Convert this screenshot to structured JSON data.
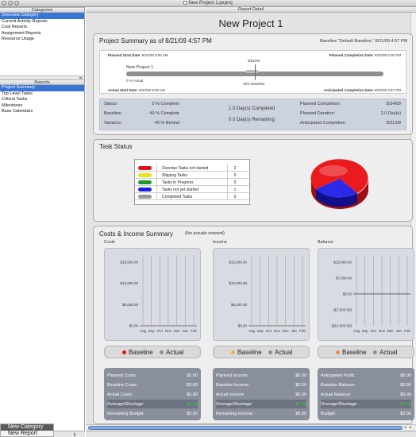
{
  "window": {
    "title": "New Project 1.pxproj"
  },
  "sidebar": {
    "categories_header": "Categories",
    "categories": [
      {
        "label": "Overview Category",
        "selected": true
      },
      {
        "label": "Current Activity Reports"
      },
      {
        "label": "Cost Reports"
      },
      {
        "label": "Assignment Reports"
      },
      {
        "label": "Resource Usage"
      }
    ],
    "reports_header": "Reports",
    "reports": [
      {
        "label": "Project Summary",
        "selected": true
      },
      {
        "label": "Top Level Tasks"
      },
      {
        "label": "Critical Tasks"
      },
      {
        "label": "Milestones"
      },
      {
        "label": "Base Calendars"
      }
    ]
  },
  "context_menu": {
    "items": [
      "New Category",
      "New Report"
    ]
  },
  "report": {
    "header": "Report Detail",
    "title": "New Project 1",
    "summary": {
      "title": "Project Summary as of 8/21/09 4:57 PM",
      "baseline": "Baseline \"Default Baseline,\" 8/21/09 4:57 PM",
      "planned_start": {
        "label": "Planned Start Date:",
        "value": "8/24/09 8:00 AM"
      },
      "planned_completion": {
        "label": "Planned Completion Date:",
        "value": "8/24/09 5:00 PM"
      },
      "actual_start": {
        "label": "Actual Start Date:",
        "value": "8/24/09 8:00 AM"
      },
      "anticipated_completion": {
        "label": "Anticipated Completion Date:",
        "value": "8/24/09 4:57 PM"
      },
      "today_marker": "8/21/09",
      "project_name": "New Project 1",
      "actual_pct": "0 % Actual",
      "baseline_pct": "49% Baseline",
      "actual_fraction": 0,
      "baseline_fraction": 0.49,
      "stats": {
        "status_label": "Status:",
        "status_value": "0 % Complete",
        "baseline_label": "Baseline:",
        "baseline_value": "49 % Complete",
        "variance_label": "Variance:",
        "variance_value": "49 % Behind",
        "days_completed": "1.0 Day(s) Completed",
        "days_remaining": "0.0 Day(s) Remaining",
        "planned_completion_label": "Planned Completion:",
        "planned_completion_value": "8/24/09",
        "planned_duration_label": "Planned Duration:",
        "planned_duration_value": "2.0 Day(s)",
        "anticipated_completion_label": "Anticipated Completion:",
        "anticipated_completion_value": "8/21/09"
      }
    },
    "task_status": {
      "title": "Task Status",
      "rows": [
        {
          "label": "Overdue Tasks not started",
          "count": "2",
          "color": "#e0141b"
        },
        {
          "label": "Slipping Tasks",
          "count": "0",
          "color": "#e8e21a"
        },
        {
          "label": "Tasks in Progress",
          "count": "0",
          "color": "#1a9a2a"
        },
        {
          "label": "Tasks not yet started",
          "count": "1",
          "color": "#1e1ee0"
        },
        {
          "label": "Completed Tasks",
          "count": "0",
          "color": "#9a9a9a"
        }
      ]
    },
    "costs_income": {
      "title": "Costs & Income Summary",
      "note": "(No actuals entered)",
      "months": [
        "Aug",
        "Sep",
        "Oct",
        "Nov",
        "Dec",
        "Jan",
        "Feb"
      ],
      "panels": [
        {
          "label": "Costs",
          "yticks": [
            "$15,000.00",
            "$10,000.00",
            "$5,000.00",
            "$0.00"
          ],
          "baseline_dot": "#e0141b",
          "legend_baseline": "Baseline",
          "legend_actual": "Actual",
          "rows": [
            {
              "k": "Planned Costs:",
              "v": "$0.00"
            },
            {
              "k": "Baseline Costs:",
              "v": "$0.00"
            },
            {
              "k": "Actual Costs:",
              "v": "$0.00"
            },
            {
              "k": "Overage/Shortage:",
              "v": "$0.00",
              "hl": true,
              "green": true
            },
            {
              "k": "Remaining Budget:",
              "v": "$0.00"
            }
          ]
        },
        {
          "label": "Income",
          "yticks": [
            "$15,000.00",
            "$10,000.00",
            "$5,000.00",
            "$0.00"
          ],
          "baseline_dot": "#e8b04a",
          "legend_baseline": "Baseline",
          "legend_actual": "Actual",
          "rows": [
            {
              "k": "Planned Income:",
              "v": "$0.00"
            },
            {
              "k": "Baseline Income:",
              "v": "$0.00"
            },
            {
              "k": "Actual Income:",
              "v": "$0.00"
            },
            {
              "k": "Overage/Shortage:",
              "v": "$0.00",
              "hl": true,
              "green": true
            },
            {
              "k": "Remaining Income:",
              "v": "$0.00"
            }
          ]
        },
        {
          "label": "Balance",
          "yticks": [
            "$15,000.00",
            "$7,500.00",
            "$0.00",
            "($7,500.00)",
            "($15,000.00)"
          ],
          "baseline_dot": "#e88a5a",
          "legend_baseline": "Baseline",
          "legend_actual": "Actual",
          "rows": [
            {
              "k": "Anticipated Profit:",
              "v": "$0.00"
            },
            {
              "k": "Baseline Balance:",
              "v": "$0.00"
            },
            {
              "k": "Actual Balance:",
              "v": "$0.00"
            },
            {
              "k": "Overage/Shortage:",
              "v": "$0.00",
              "hl": true,
              "green": true
            },
            {
              "k": "Budget:",
              "v": "$0.00"
            }
          ]
        }
      ]
    }
  }
}
